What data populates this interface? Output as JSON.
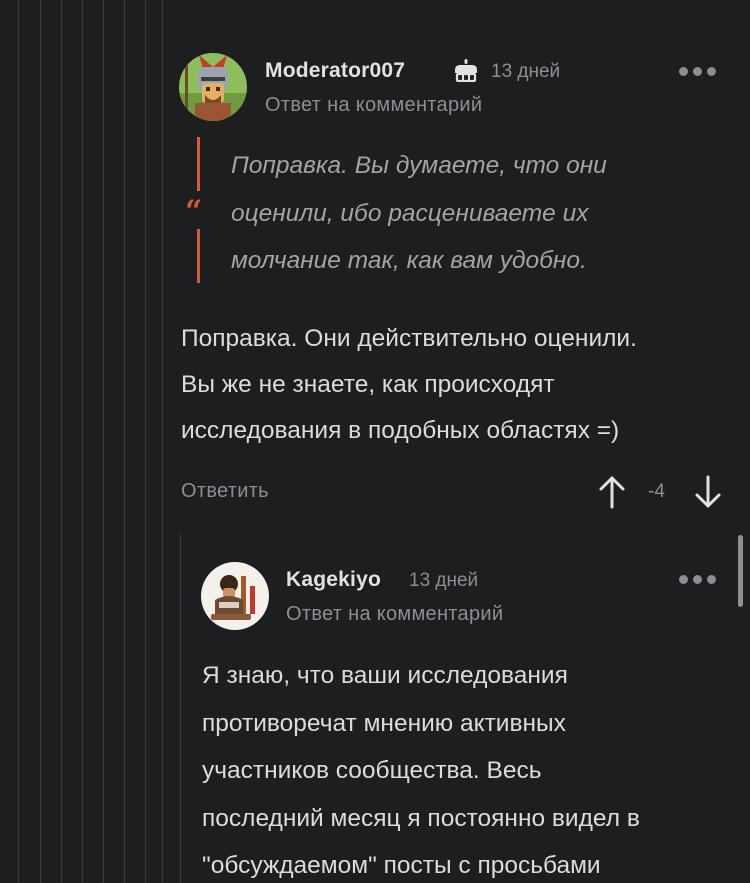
{
  "comment1": {
    "username": "Moderator007",
    "badge_icon": "cake-icon",
    "time": "13 дней",
    "reply_to": "Ответ на комментарий",
    "quote": [
      "Поправка. Вы думаете, что они",
      "оценили, ибо расцениваете их",
      "молчание так, как вам удобно."
    ],
    "body": [
      "Поправка. Они действительно оценили.",
      "Вы же не знаете, как происходят",
      "исследования в подобных областях =)"
    ],
    "reply_label": "Ответить",
    "score": "-4"
  },
  "comment2": {
    "username": "Kagekiyo",
    "time": "13 дней",
    "reply_to": "Ответ на комментарий",
    "body": [
      "Я знаю, что ваши исследования",
      "противоречат мнению активных",
      "участников сообщества. Весь",
      "последний месяц я постоянно видел в",
      "\"обсуждаемом\" посты с просьбами"
    ]
  },
  "colors": {
    "background": "#1d1e20",
    "accent_quote": "#d7583f",
    "muted_text": "#8d8e93",
    "thread_line": "#3a3b3f"
  }
}
